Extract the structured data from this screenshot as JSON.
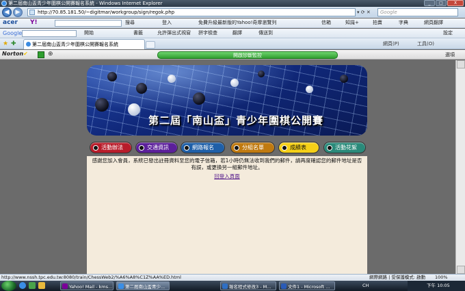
{
  "window": {
    "title": "第二屆南山盃青少年圍棋公開賽報名系統 - Windows Internet Explorer",
    "controls": [
      "_",
      "□",
      "X"
    ]
  },
  "address": {
    "url": "http://70.85.181.50/~digitmar/workgroup/sign/regok.php",
    "search_placeholder": "Google"
  },
  "toolbars": {
    "acer": "acer",
    "yahoo": "Y!",
    "search_label": "搜尋",
    "login": "登入",
    "promo": "免費升級最新版的Yahoo!奇摩瀏覽列",
    "mail": "信箱",
    "knowledge": "知識+",
    "auction": "拍賣",
    "dictionary": "字典",
    "translate": "網頁翻譯",
    "settings": "設定",
    "google": "Google",
    "open": "開始",
    "bookmarks": "書籤",
    "popups": "允許彈出式視窗",
    "spell": "拼字檢查",
    "translate2": "翻譯",
    "send": "傳送到"
  },
  "tab": {
    "title": "第二屆南山盃青少年圍棋公開賽報名系統",
    "page_menu": "網頁(P)",
    "tools_menu": "工具(O)"
  },
  "norton": {
    "logo": "Norton",
    "safe_label": "開啟診斷監控",
    "options": "選項"
  },
  "banner": {
    "title": "第二屆「南山盃」青少年圍棋公開賽"
  },
  "nav": [
    "活動辦法",
    "交通資訊",
    "網路報名",
    "分組名單",
    "成績表",
    "活動花絮"
  ],
  "nav_colors": [
    "#b81c2a",
    "#5b1f9a",
    "#1f5fa8",
    "#c07a10",
    "#f5d018",
    "#2a8a7a"
  ],
  "content": {
    "message": "感謝您加入會員，系統已發出註冊資料至您的電子信箱，若1小時仍無法收到我們的郵件，請再度確認您的郵件地址是否有誤，或更換另一組郵件地址。",
    "relogin_link": "回登入頁面"
  },
  "status": {
    "url": "http://www.nssh.tpc.edu.tw:8080/train/ChessWeb2/%A6%A8%C1Z%AA%ED.html",
    "zone": "網際網路 | 受保護模式: 啟動",
    "zoom": "100%"
  },
  "taskbar": {
    "tasks": [
      "Yahoo! Mail - kms...",
      "第二屆南山盃青少...",
      "報名程式修改3 - M...",
      "文件1 - Microsoft ..."
    ],
    "lang": "CH",
    "time": "下午 10:05"
  }
}
